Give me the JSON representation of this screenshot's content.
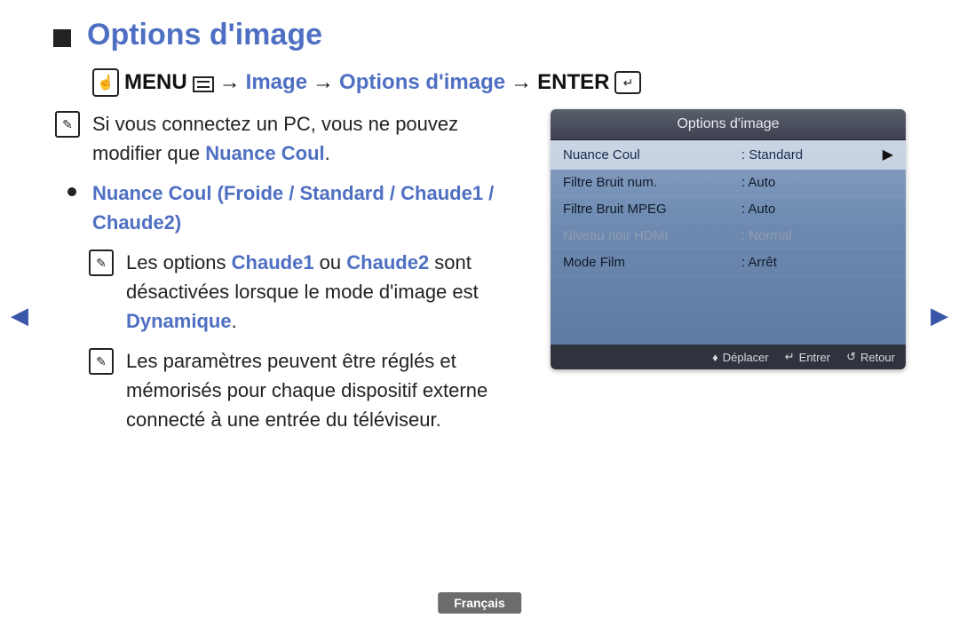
{
  "title": "Options d'image",
  "breadcrumb": {
    "menu_label": "MENU",
    "image": "Image",
    "options": "Options d'image",
    "enter_label": "ENTER"
  },
  "note1_a": "Si vous connectez un PC, vous ne pouvez modifier que ",
  "note1_b": "Nuance Coul",
  "note1_c": ".",
  "section_heading": "Nuance Coul (Froide / Standard / Chaude1 / Chaude2)",
  "note2_a": "Les options ",
  "note2_b": "Chaude1",
  "note2_c": " ou ",
  "note2_d": "Chaude2",
  "note2_e": " sont désactivées lorsque le mode d'image est ",
  "note2_f": "Dynamique",
  "note2_g": ".",
  "note3": "Les paramètres peuvent être réglés et mémorisés pour chaque dispositif externe connecté à une entrée du téléviseur.",
  "osd": {
    "title": "Options d'image",
    "rows": [
      {
        "label": "Nuance Coul",
        "value": ": Standard",
        "selected": true
      },
      {
        "label": "Filtre Bruit num.",
        "value": ": Auto"
      },
      {
        "label": "Filtre Bruit MPEG",
        "value": ": Auto"
      },
      {
        "label": "Niveau noir HDMI",
        "value": ": Normal",
        "disabled": true
      },
      {
        "label": "Mode Film",
        "value": ": Arrêt"
      }
    ],
    "footer": {
      "move": "Déplacer",
      "enter": "Entrer",
      "return": "Retour"
    }
  },
  "language": "Français"
}
